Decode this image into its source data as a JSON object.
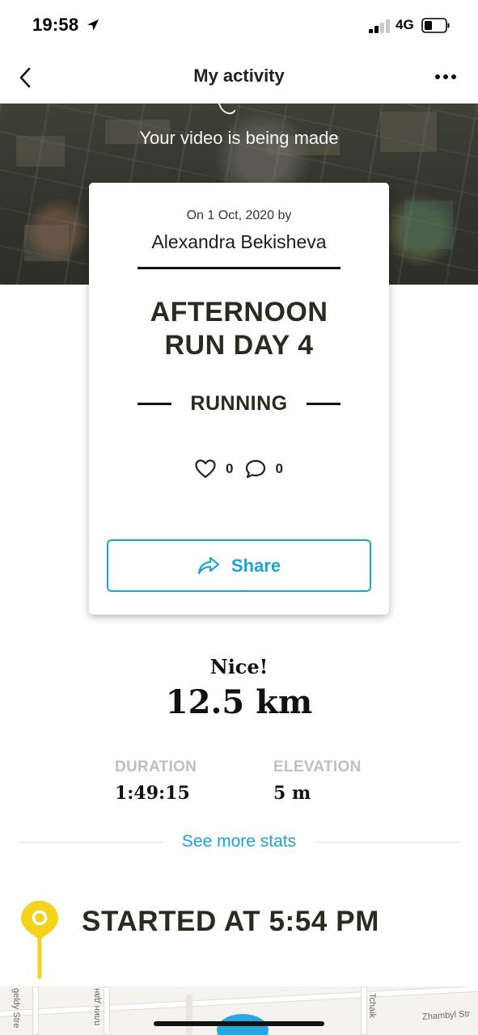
{
  "status_bar": {
    "time": "19:58",
    "network": "4G",
    "location_icon": "location-arrow-icon",
    "signal_icon": "signal-bars-icon",
    "battery_icon": "battery-icon"
  },
  "nav": {
    "title": "My activity",
    "back_icon": "chevron-left-icon",
    "more_icon": "more-horizontal-icon"
  },
  "hero": {
    "video_message": "Your video is being made"
  },
  "card": {
    "date_line": "On 1 Oct, 2020 by",
    "author": "Alexandra Bekisheva",
    "title_line1": "AFTERNOON",
    "title_line2": "RUN DAY 4",
    "activity_type": "RUNNING",
    "likes": "0",
    "comments": "0",
    "share_label": "Share"
  },
  "stats": {
    "kudos": "Nice!",
    "distance": "12.5 km",
    "duration_label": "DURATION",
    "duration_value": "1:49:15",
    "elevation_label": "ELEVATION",
    "elevation_value": "5 m",
    "more_link": "See more stats"
  },
  "timeline": {
    "start_text": "STARTED AT 5:54 PM"
  },
  "map": {
    "streets": [
      "geldy Stre",
      "плин дан",
      "Tchaik",
      "Zhambyl Str"
    ]
  },
  "colors": {
    "accent": "#1ca3d3",
    "pin": "#f5d31c",
    "title_dark": "#2b2a1e",
    "label_gray": "#bfbfbf"
  }
}
